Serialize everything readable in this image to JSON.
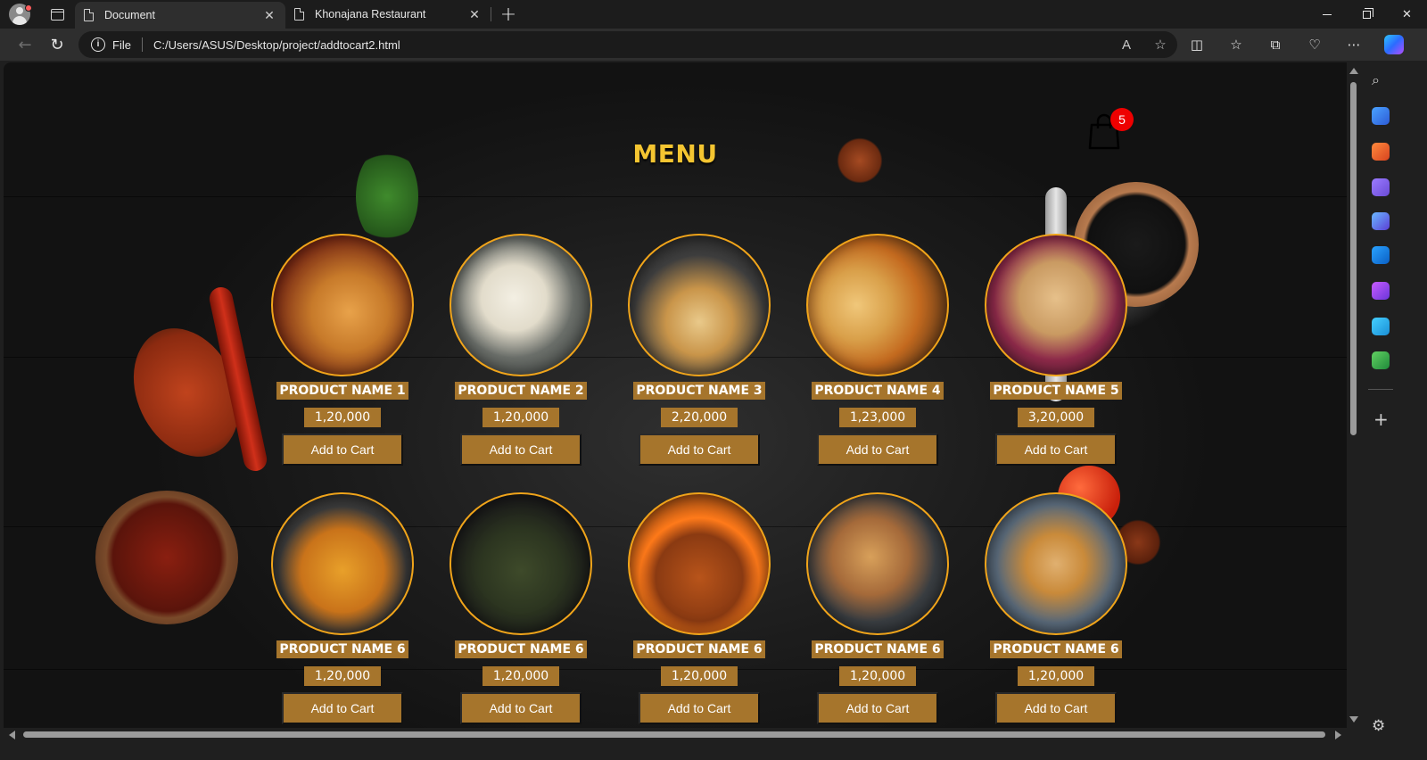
{
  "browser": {
    "tabs": [
      {
        "title": "Document",
        "active": true
      },
      {
        "title": "Khonajana Restaurant",
        "active": false
      }
    ],
    "new_tab_symbol": "+",
    "address": {
      "scheme_label": "File",
      "url": "C:/Users/ASUS/Desktop/project/addtocart2.html"
    },
    "icons": [
      "back-icon",
      "refresh-icon",
      "info-icon",
      "read-aloud-icon",
      "favorite-star-icon",
      "split-screen-icon",
      "favorites-icon",
      "collections-icon",
      "performance-icon",
      "more-icon",
      "copilot-icon"
    ],
    "sidebar_icons": [
      "search-icon",
      "shopping-tag-icon",
      "tools-icon",
      "games-icon",
      "bing-chat-icon",
      "outlook-icon",
      "drop-icon",
      "send-icon",
      "tree-icon",
      "add-icon",
      "settings-icon"
    ]
  },
  "page": {
    "menu_title": "MENU",
    "cart_count": "5",
    "accent_color": "#f4c531",
    "card_color": "#a6752c",
    "border_color": "#f0a41a",
    "products": [
      {
        "name": "PRODUCT NAME 1",
        "price": "1,20,000",
        "button": "Add to Cart",
        "dish": "dosa"
      },
      {
        "name": "PRODUCT NAME 2",
        "price": "1,20,000",
        "button": "Add to Cart",
        "dish": "idli"
      },
      {
        "name": "PRODUCT NAME 3",
        "price": "2,20,000",
        "button": "Add to Cart",
        "dish": "paratha"
      },
      {
        "name": "PRODUCT NAME 4",
        "price": "1,23,000",
        "button": "Add to Cart",
        "dish": "puri"
      },
      {
        "name": "PRODUCT NAME 5",
        "price": "3,20,000",
        "button": "Add to Cart",
        "dish": "aloo-paratha"
      },
      {
        "name": "PRODUCT NAME 6",
        "price": "1,20,000",
        "button": "Add to Cart",
        "dish": "chicken-curry"
      },
      {
        "name": "PRODUCT NAME 6",
        "price": "1,20,000",
        "button": "Add to Cart",
        "dish": "green-curry"
      },
      {
        "name": "PRODUCT NAME 6",
        "price": "1,20,000",
        "button": "Add to Cart",
        "dish": "grilled-chicken"
      },
      {
        "name": "PRODUCT NAME 6",
        "price": "1,20,000",
        "button": "Add to Cart",
        "dish": "fish"
      },
      {
        "name": "PRODUCT NAME 6",
        "price": "1,20,000",
        "button": "Add to Cart",
        "dish": "thali"
      }
    ]
  }
}
